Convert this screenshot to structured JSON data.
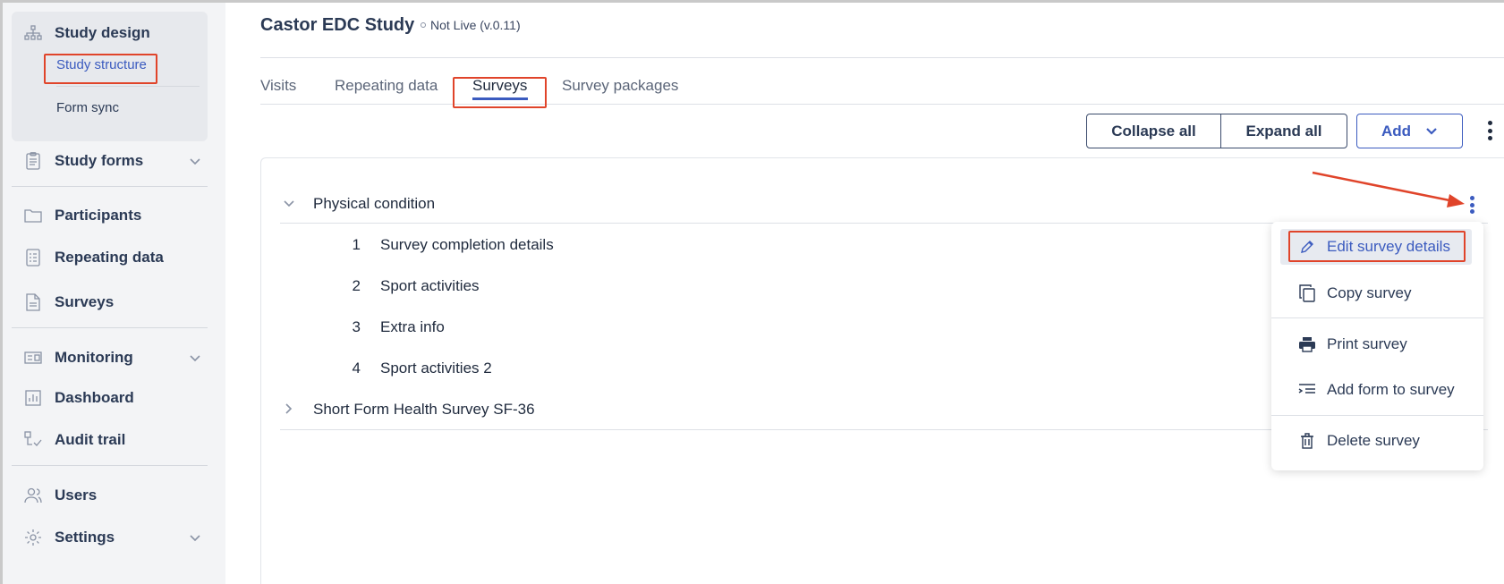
{
  "header": {
    "title": "Castor EDC Study",
    "status": "Not Live (v.0.11)"
  },
  "sidebar": {
    "study_design": {
      "label": "Study design",
      "sub": [
        "Study structure",
        "Form sync"
      ]
    },
    "items": [
      {
        "label": "Study forms"
      },
      {
        "label": "Participants"
      },
      {
        "label": "Repeating data"
      },
      {
        "label": "Surveys"
      },
      {
        "label": "Monitoring"
      },
      {
        "label": "Dashboard"
      },
      {
        "label": "Audit trail"
      },
      {
        "label": "Users"
      },
      {
        "label": "Settings"
      }
    ]
  },
  "tabs": [
    "Visits",
    "Repeating data",
    "Surveys",
    "Survey packages"
  ],
  "active_tab": "Surveys",
  "toolbar": {
    "collapse": "Collapse all",
    "expand": "Expand all",
    "add": "Add"
  },
  "surveys": [
    {
      "title": "Physical condition",
      "expanded": true,
      "forms": [
        {
          "num": "1",
          "label": "Survey completion details"
        },
        {
          "num": "2",
          "label": "Sport activities"
        },
        {
          "num": "3",
          "label": "Extra info"
        },
        {
          "num": "4",
          "label": "Sport activities 2"
        }
      ]
    },
    {
      "title": "Short Form Health Survey SF-36",
      "expanded": false
    }
  ],
  "menu": {
    "items": [
      {
        "label": "Edit survey details",
        "icon": "pencil-icon"
      },
      {
        "label": "Copy survey",
        "icon": "copy-icon"
      },
      {
        "label": "Print survey",
        "icon": "printer-icon"
      },
      {
        "label": "Add form to survey",
        "icon": "add-form-icon"
      },
      {
        "label": "Delete survey",
        "icon": "trash-icon"
      }
    ]
  },
  "colors": {
    "accent": "#3b5bbf",
    "highlight": "#e0442a",
    "sidebar_bg": "#f3f4f6"
  }
}
